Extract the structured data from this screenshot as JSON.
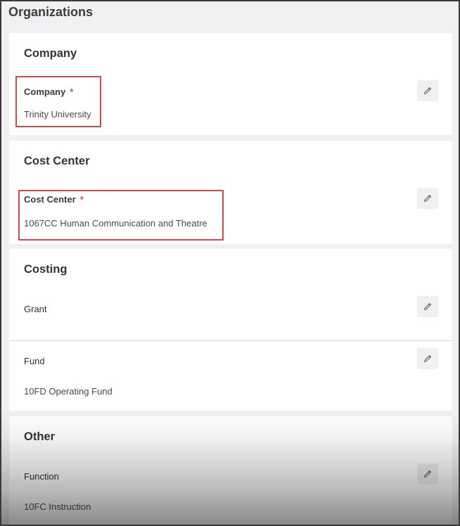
{
  "page": {
    "title": "Organizations"
  },
  "company": {
    "heading": "Company",
    "field_label": "Company",
    "required_mark": "*",
    "value": "Trinity University"
  },
  "cost_center": {
    "heading": "Cost Center",
    "field_label": "Cost Center",
    "required_mark": "*",
    "value": "1067CC Human Communication and Theatre"
  },
  "costing": {
    "heading": "Costing",
    "grant_label": "Grant",
    "fund_label": "Fund",
    "fund_value": "10FD Operating Fund"
  },
  "other": {
    "heading": "Other",
    "function_label": "Function",
    "function_value": "10FC Instruction"
  },
  "icons": {
    "edit": "pencil-icon"
  },
  "colors": {
    "highlight": "#d8484a",
    "required": "#d9534f"
  }
}
